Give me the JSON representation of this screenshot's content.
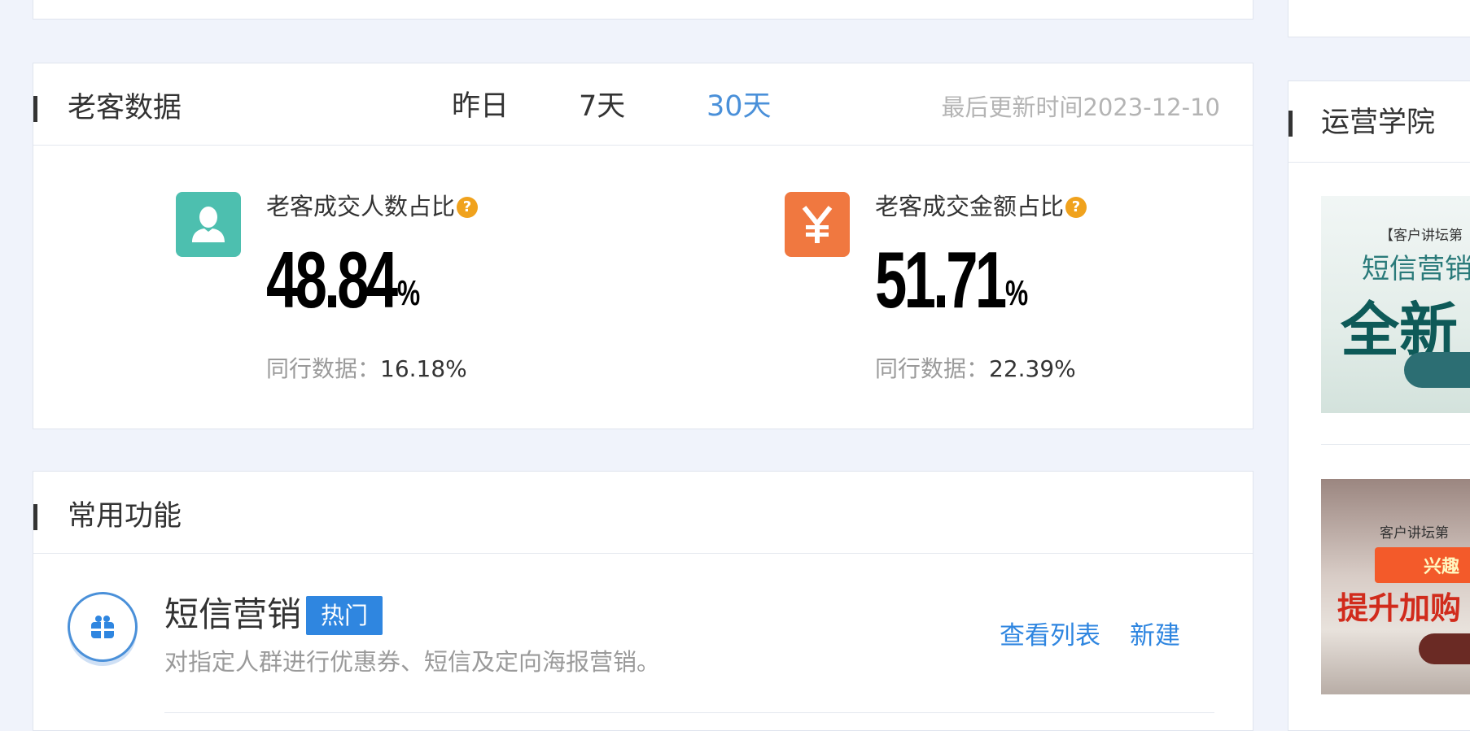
{
  "old_customer": {
    "title": "老客数据",
    "ranges": [
      {
        "label": "昨日",
        "active": false
      },
      {
        "label": "7天",
        "active": false
      },
      {
        "label": "30天",
        "active": true
      }
    ],
    "updated": "最后更新时间2023-12-10",
    "metrics": [
      {
        "label": "老客成交人数占比",
        "help": "?",
        "icon": "user-icon",
        "value": "48.84",
        "unit": "%",
        "peer_label": "同行数据：",
        "peer_value": "16.18%"
      },
      {
        "label": "老客成交金额占比",
        "help": "?",
        "icon": "yen-icon",
        "value": "51.71",
        "unit": "%",
        "peer_label": "同行数据：",
        "peer_value": "22.39%"
      }
    ]
  },
  "common_functions": {
    "title": "常用功能",
    "items": [
      {
        "title": "短信营销",
        "badge": "热门",
        "icon": "gift-icon",
        "desc": "对指定人群进行优惠券、短信及定向海报营销。",
        "links": [
          "查看列表",
          "新建"
        ]
      }
    ]
  },
  "side": {
    "title": "运营学院",
    "banners": [
      {
        "header": "【客户讲坛第",
        "line1": "短信营销",
        "line2": "全新"
      },
      {
        "header": "客户讲坛第",
        "line1": "兴趣",
        "line2": "提升加购"
      }
    ]
  },
  "colors": {
    "accent": "#4a90d9",
    "badge": "#2f86e0",
    "help": "#f0a21d",
    "teal": "#4dbfaf",
    "orange": "#f07840"
  }
}
